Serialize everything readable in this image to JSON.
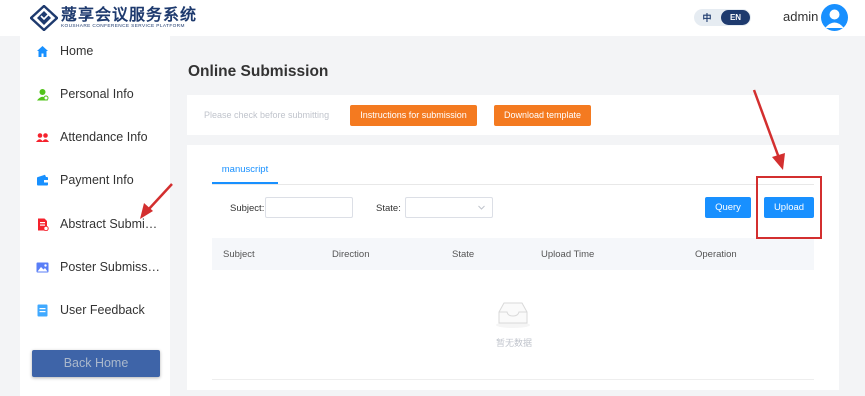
{
  "header": {
    "logo_cn": "蔻享会议服务系统",
    "logo_en": "KOUSHARE CONFERENCE SERVICE PLATFORM",
    "lang_cn": "中",
    "lang_en": "EN",
    "username": "admin",
    "brand_color": "#1e3a6e"
  },
  "sidebar": {
    "items": [
      {
        "label": "Home",
        "icon": "home-icon",
        "color": "#1890ff"
      },
      {
        "label": "Personal Info",
        "icon": "person-icon",
        "color": "#52c41a"
      },
      {
        "label": "Attendance Info",
        "icon": "group-icon",
        "color": "#f5222d"
      },
      {
        "label": "Payment Info",
        "icon": "wallet-icon",
        "color": "#1890ff"
      },
      {
        "label": "Abstract Submission",
        "icon": "document-icon",
        "color": "#f5222d"
      },
      {
        "label": "Poster Submission",
        "icon": "image-icon",
        "color": "#597ef7"
      },
      {
        "label": "User Feedback",
        "icon": "feedback-icon",
        "color": "#40a9ff"
      }
    ],
    "back_home": "Back Home"
  },
  "main": {
    "title": "Online Submission",
    "hint": "Please check before submitting",
    "instructions_btn": "Instructions for submission",
    "download_btn": "Download template",
    "tab": "manuscript",
    "subject_label": "Subject",
    "state_label": "State",
    "subject_value": "",
    "state_value": "",
    "query_btn": "Query",
    "upload_btn": "Upload",
    "columns": [
      "Subject",
      "Direction",
      "State",
      "Upload Time",
      "Operation"
    ],
    "empty_text": "暂无数据",
    "accent": "#1890ff",
    "orange": "#f47a20"
  }
}
